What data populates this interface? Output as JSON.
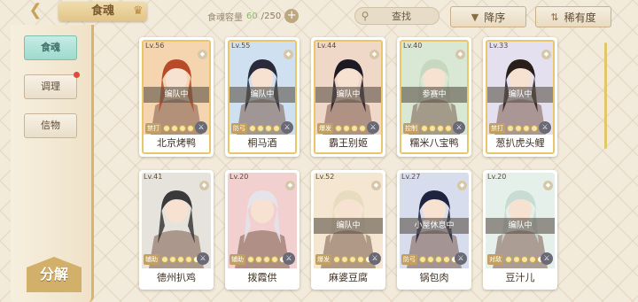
{
  "topbar": {
    "title": "食魂",
    "capacity_label": "食魂容量",
    "capacity_current": "60",
    "capacity_max": "/250",
    "search_label": "查找",
    "sort_desc_label": "降序",
    "sort_rarity_label": "稀有度"
  },
  "sidebar": {
    "items": [
      {
        "label": "食魂"
      },
      {
        "label": "调理"
      },
      {
        "label": "信物"
      }
    ],
    "decompose_label": "分解"
  },
  "cards": [
    {
      "level": "Lv.56",
      "status": "编队中",
      "tag": "禁打",
      "stars": 5,
      "name": "北京烤鸭",
      "bg": "#f5d4b0",
      "hair": "#b84a2a"
    },
    {
      "level": "Lv.55",
      "status": "编队中",
      "tag": "防弓",
      "stars": 5,
      "name": "桐马酒",
      "bg": "#cfe0f0",
      "hair": "#2a2a3a"
    },
    {
      "level": "Lv.44",
      "status": "编队中",
      "tag": "爆发",
      "stars": 5,
      "name": "霸王别姬",
      "bg": "#f0d8c8",
      "hair": "#1e1a24"
    },
    {
      "level": "Lv.40",
      "status": "参赛中",
      "tag": "控制",
      "stars": 5,
      "name": "糯米八宝鸭",
      "bg": "#d8e8d4",
      "hair": "#c8d8c0"
    },
    {
      "level": "Lv.33",
      "status": "编队中",
      "tag": "禁打",
      "stars": 5,
      "name": "葱扒虎头鲤",
      "bg": "#e4e0f0",
      "hair": "#2a1e1a"
    },
    {
      "level": "Lv.41",
      "status": "",
      "tag": "辅助",
      "stars": 4,
      "name": "德州扒鸡",
      "bg": "#e6e2dc",
      "hair": "#3a3a3a"
    },
    {
      "level": "Lv.20",
      "status": "",
      "tag": "辅助",
      "stars": 4,
      "name": "拨霞供",
      "bg": "#f2d0d0",
      "hair": "#e4e4ea"
    },
    {
      "level": "Lv.52",
      "status": "编队中",
      "tag": "爆发",
      "stars": 4,
      "name": "麻婆豆腐",
      "bg": "#f4e6d0",
      "hair": "#e8dcc0"
    },
    {
      "level": "Lv.27",
      "status": "小屋休息中",
      "tag": "防弓",
      "stars": 4,
      "name": "锅包肉",
      "bg": "#d8ddee",
      "hair": "#1e2440"
    },
    {
      "level": "Lv.20",
      "status": "编队中",
      "tag": "对敌",
      "stars": 4,
      "name": "豆汁儿",
      "bg": "#e6f0ea",
      "hair": "#c8dcd4"
    }
  ]
}
